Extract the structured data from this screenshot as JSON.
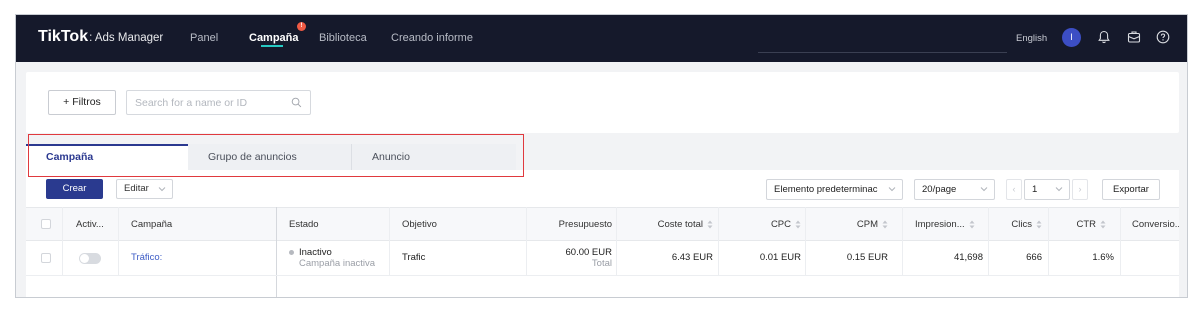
{
  "nav": {
    "logo_main": "TikTok",
    "logo_sub": ": Ads Manager",
    "items": [
      {
        "label": "Panel"
      },
      {
        "label": "Campaña"
      },
      {
        "label": "Biblioteca"
      },
      {
        "label": "Creando informe"
      }
    ],
    "badge": "!",
    "language": "English",
    "avatar_initial": "I",
    "accent": "#27c9c3",
    "background": "#15192b"
  },
  "filters": {
    "button_label": "+ Filtros",
    "search_placeholder": "Search for a name or ID"
  },
  "tabs": [
    {
      "label": "Campaña"
    },
    {
      "label": "Grupo de anuncios"
    },
    {
      "label": "Anuncio"
    }
  ],
  "toolbar": {
    "create_label": "Crear",
    "edit_label": "Editar",
    "column_preset": "Elemento predeterminac",
    "page_size": "20/page",
    "page": "1",
    "export_label": "Exportar",
    "primary_color": "#2a3a8f",
    "highlight_color": "#e0393e"
  },
  "table": {
    "headers": {
      "active": "Activ...",
      "campaign": "Campaña",
      "status": "Estado",
      "objective": "Objetivo",
      "budget": "Presupuesto",
      "total_cost": "Coste total",
      "cpc": "CPC",
      "cpm": "CPM",
      "impressions": "Impresion...",
      "clicks": "Clics",
      "ctr": "CTR",
      "conversions": "Conversio..."
    },
    "rows": [
      {
        "campaign": "Tráfico:",
        "status": "Inactivo",
        "status_sub": "Campaña inactiva",
        "objective": "Trafic",
        "budget": "60.00 EUR",
        "budget_sub": "Total",
        "total_cost": "6.43 EUR",
        "cpc": "0.01 EUR",
        "cpm": "0.15 EUR",
        "impressions": "41,698",
        "clicks": "666",
        "ctr": "1.6%"
      }
    ]
  }
}
